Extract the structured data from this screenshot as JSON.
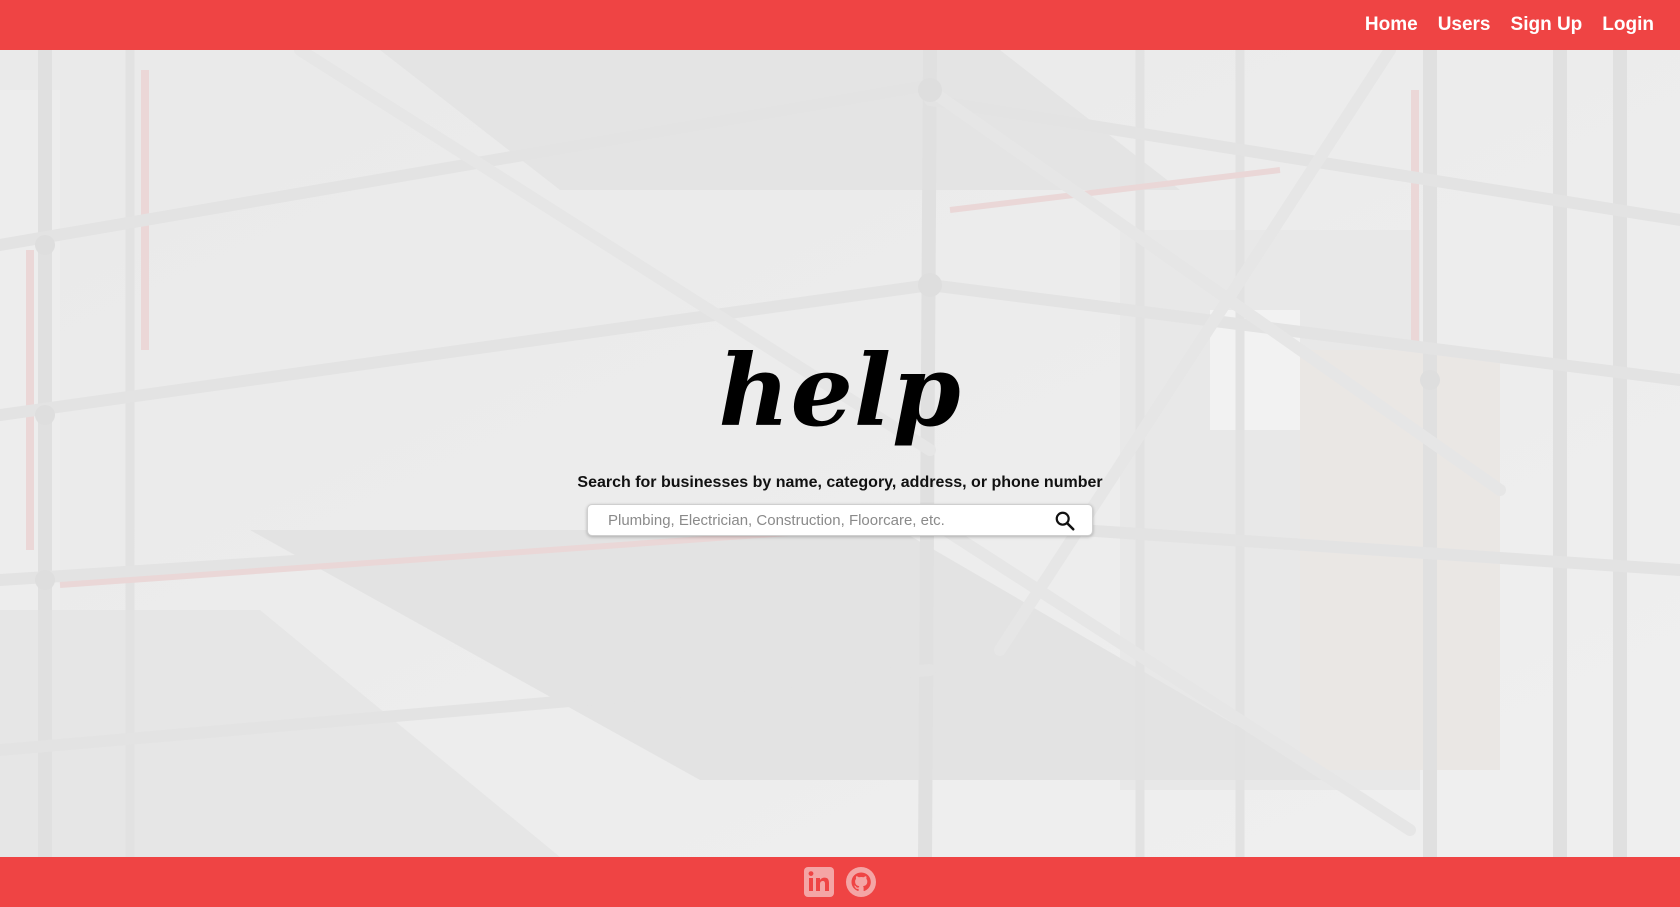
{
  "nav": {
    "items": [
      {
        "label": "Home"
      },
      {
        "label": "Users"
      },
      {
        "label": "Sign Up"
      },
      {
        "label": "Login"
      }
    ]
  },
  "hero": {
    "logo": "help",
    "subtitle": "Search for businesses by name, category, address, or phone number"
  },
  "search": {
    "placeholder": "Plumbing, Electrician, Construction, Floorcare, etc.",
    "value": "",
    "icon": "search-icon"
  },
  "footer": {
    "icons": [
      "linkedin-icon",
      "github-icon"
    ]
  },
  "colors": {
    "brand": "#ef4444",
    "nav_text": "#ffffff",
    "social_icon": "#f4a5a5",
    "background": "#eeeeee"
  }
}
